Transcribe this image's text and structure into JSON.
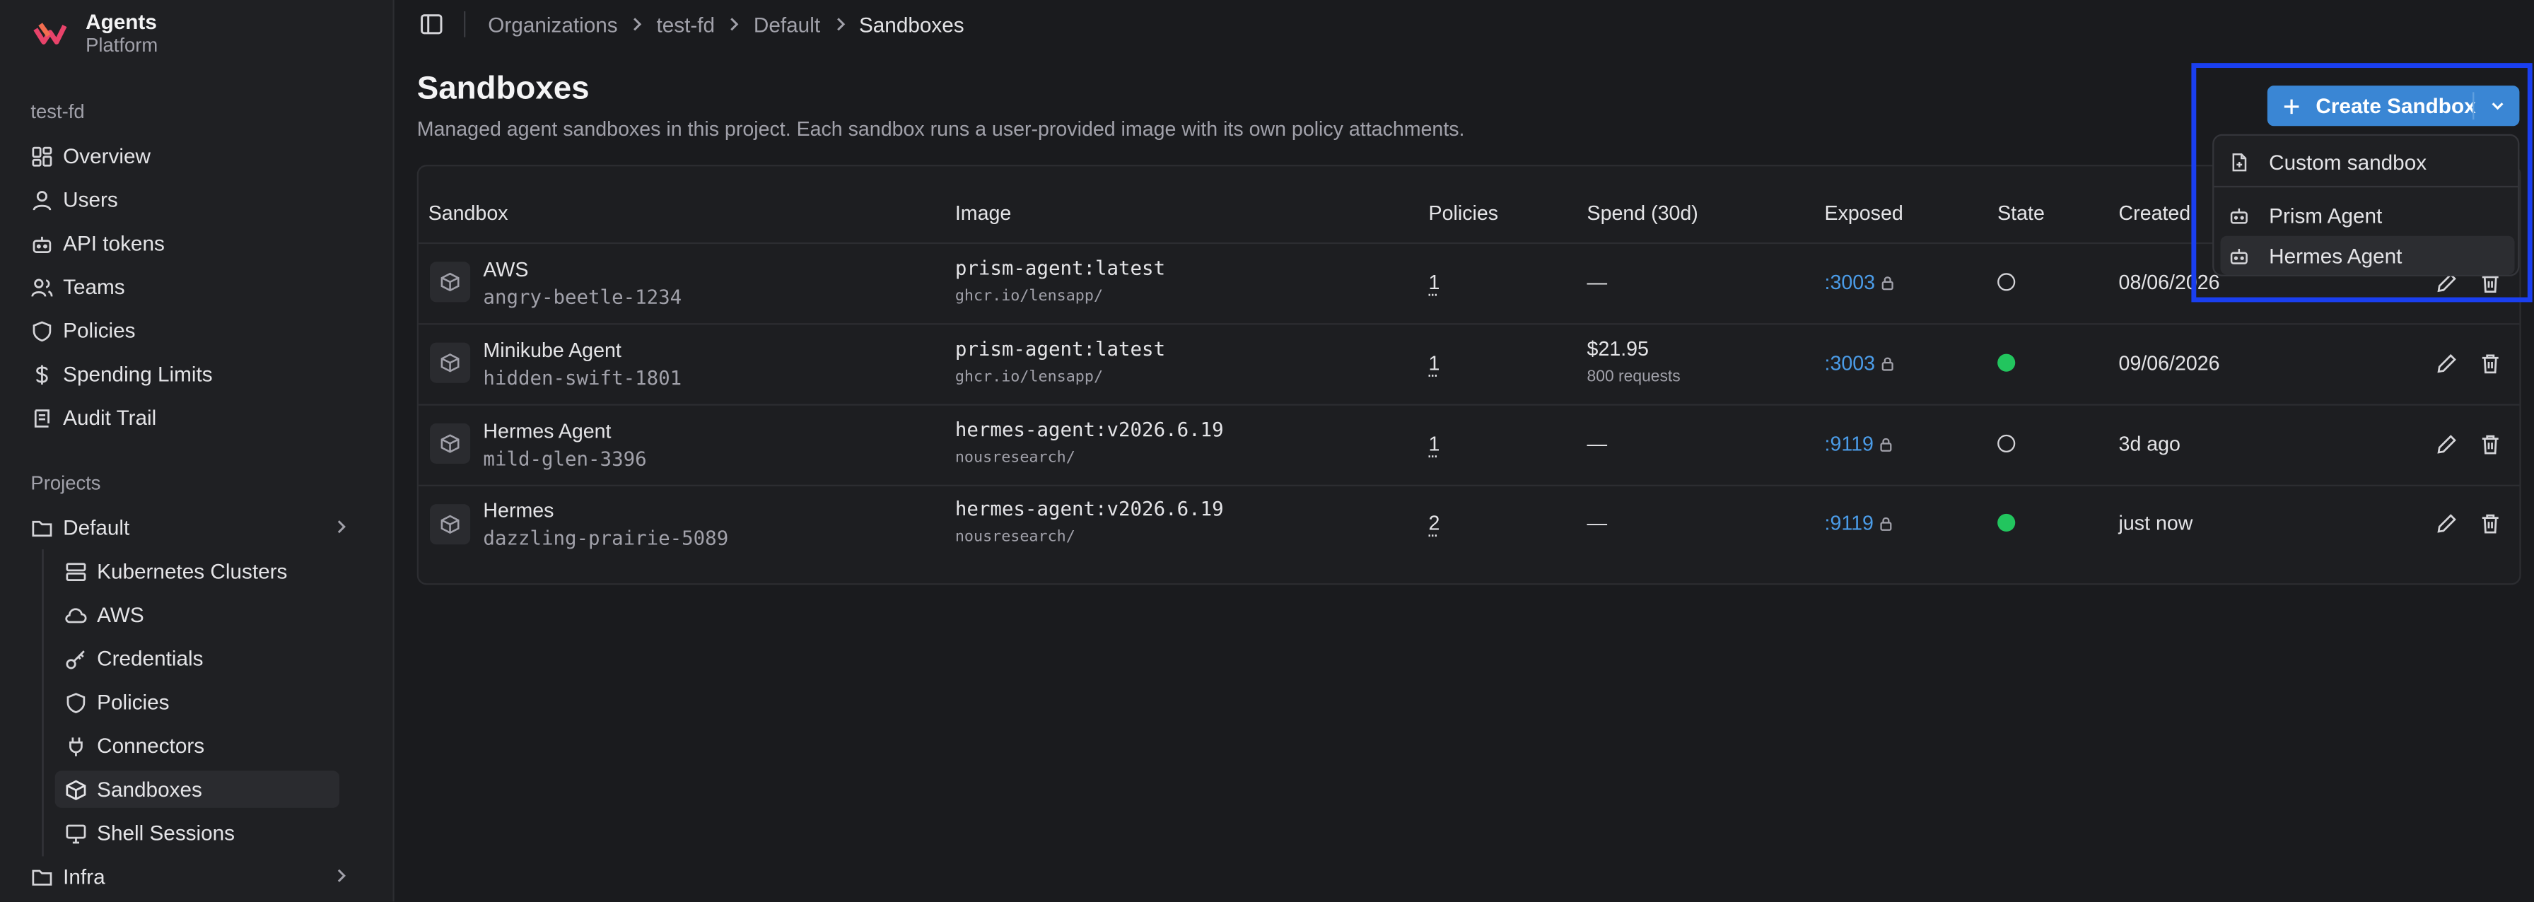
{
  "brand": {
    "name": "Agents",
    "subtitle": "Platform"
  },
  "sidebar": {
    "org_label": "test-fd",
    "items": [
      {
        "label": "Overview",
        "icon": "grid-icon"
      },
      {
        "label": "Users",
        "icon": "user-icon"
      },
      {
        "label": "API tokens",
        "icon": "bot-icon"
      },
      {
        "label": "Teams",
        "icon": "users-icon"
      },
      {
        "label": "Policies",
        "icon": "shield-icon"
      },
      {
        "label": "Spending Limits",
        "icon": "dollar-icon"
      },
      {
        "label": "Audit Trail",
        "icon": "scroll-icon"
      }
    ],
    "projects_heading": "Projects",
    "project": {
      "label": "Default",
      "icon": "folder-icon"
    },
    "project_items": [
      {
        "label": "Kubernetes Clusters",
        "icon": "server-icon"
      },
      {
        "label": "AWS",
        "icon": "cloud-icon"
      },
      {
        "label": "Credentials",
        "icon": "key-icon"
      },
      {
        "label": "Policies",
        "icon": "shield-icon"
      },
      {
        "label": "Connectors",
        "icon": "plug-icon"
      },
      {
        "label": "Sandboxes",
        "icon": "box-icon"
      },
      {
        "label": "Shell Sessions",
        "icon": "monitor-icon"
      }
    ],
    "infra": {
      "label": "Infra",
      "icon": "folder-icon"
    }
  },
  "breadcrumb": [
    "Organizations",
    "test-fd",
    "Default",
    "Sandboxes"
  ],
  "page": {
    "title": "Sandboxes",
    "description": "Managed agent sandboxes in this project. Each sandbox runs a user-provided image with its own policy attachments."
  },
  "create_button": {
    "label": "Create Sandbox"
  },
  "dropdown": {
    "items": [
      "Custom sandbox",
      "Prism Agent",
      "Hermes Agent"
    ]
  },
  "table": {
    "headers": [
      "Sandbox",
      "Image",
      "Policies",
      "Spend (30d)",
      "Exposed",
      "State",
      "Created"
    ],
    "rows": [
      {
        "name": "AWS",
        "id": "angry-beetle-1234",
        "image": "prism-agent:latest",
        "registry": "ghcr.io/lensapp/",
        "policies": "1",
        "spend": "—",
        "spend_sub": "",
        "exposed": ":3003",
        "state": "stopped",
        "created": "08/06/2026"
      },
      {
        "name": "Minikube Agent",
        "id": "hidden-swift-1801",
        "image": "prism-agent:latest",
        "registry": "ghcr.io/lensapp/",
        "policies": "1",
        "spend": "$21.95",
        "spend_sub": "800 requests",
        "exposed": ":3003",
        "state": "running",
        "created": "09/06/2026"
      },
      {
        "name": "Hermes Agent",
        "id": "mild-glen-3396",
        "image": "hermes-agent:v2026.6.19",
        "registry": "nousresearch/",
        "policies": "1",
        "spend": "—",
        "spend_sub": "",
        "exposed": ":9119",
        "state": "stopped",
        "created": "3d ago"
      },
      {
        "name": "Hermes",
        "id": "dazzling-prairie-5089",
        "image": "hermes-agent:v2026.6.19",
        "registry": "nousresearch/",
        "policies": "2",
        "spend": "—",
        "spend_sub": "",
        "exposed": ":9119",
        "state": "running",
        "created": "just now"
      }
    ]
  },
  "colors": {
    "accent": "#3a86d4",
    "link": "#4b9ce8",
    "running": "#22c55e",
    "highlight": "#1a3ff0"
  }
}
